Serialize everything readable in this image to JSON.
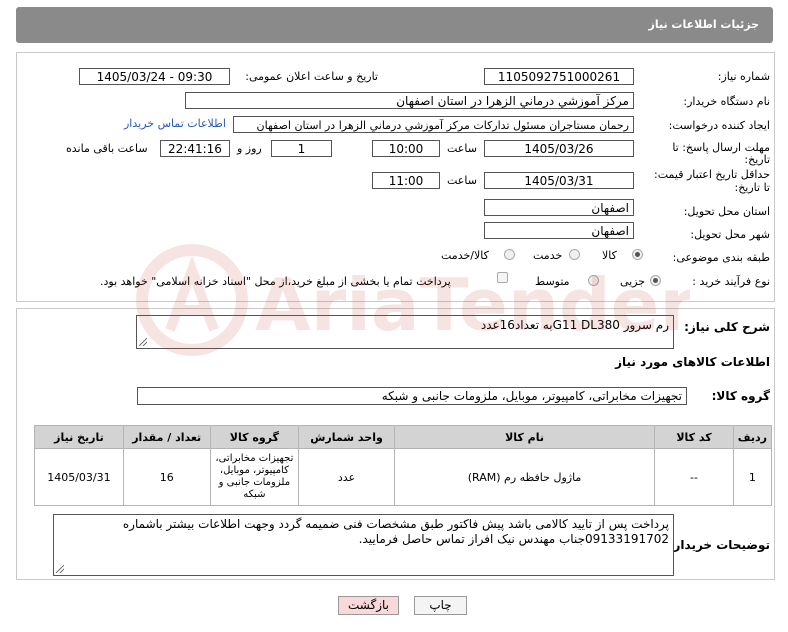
{
  "header": {
    "title": "جزئیات اطلاعات نیاز"
  },
  "need": {
    "number_label": "شماره نیاز:",
    "number": "1105092751000261",
    "announce_label": "تاریخ و ساعت اعلان عمومی:",
    "announce_value": "1405/03/24 - 09:30",
    "buyer_label": "نام دستگاه خریدار:",
    "buyer": "مرکز آموزشي درماني الزهرا در استان اصفهان",
    "creator_label": "ایجاد کننده درخواست:",
    "creator": "رحمان مستاجران مسئول تدارکات مرکز آموزشي درماني الزهرا در استان اصفهان",
    "contact_link": "اطلاعات تماس خریدار",
    "deadline_label_1": "مهلت ارسال پاسخ: تا",
    "deadline_label_2": "تاریخ:",
    "deadline_date": "1405/03/26",
    "time_label": "ساعت",
    "deadline_time": "10:00",
    "days_value": "1",
    "days_label": "روز و",
    "remaining_time": "22:41:16",
    "remaining_label": "ساعت باقی مانده",
    "validity_label_1": "حداقل تاریخ اعتبار قیمت:",
    "validity_label_2": "تا تاریخ:",
    "validity_date": "1405/03/31",
    "validity_time": "11:00",
    "province_label": "استان محل تحویل:",
    "province": "اصفهان",
    "city_label": "شهر محل تحویل:",
    "city": "اصفهان",
    "category_label": "طبقه بندی موضوعی:",
    "category_options": [
      "کالا",
      "خدمت",
      "کالا/خدمت"
    ],
    "category_selected": "کالا",
    "process_label": "نوع فرآیند خرید :",
    "process_options": [
      "جزیی",
      "متوسط"
    ],
    "process_selected": "جزیی",
    "payment_note": "پرداخت تمام یا بخشی از مبلغ خرید،از محل \"اسناد خزانه اسلامی\" خواهد بود."
  },
  "description": {
    "label": "شرح کلی نیاز:",
    "value": "رم سرور G11 DL380به تعداد16عدد"
  },
  "goods": {
    "section_title": "اطلاعات کالاهای مورد نیاز",
    "group_label": "گروه کالا:",
    "group_value": "تجهیزات مخابراتی، کامپیوتر، موبایل، ملزومات جانبی و شبکه",
    "columns": [
      "ردیف",
      "کد کالا",
      "نام کالا",
      "واحد شمارش",
      "گروه کالا",
      "تعداد / مقدار",
      "تاریخ نیاز"
    ],
    "rows": [
      {
        "row": "1",
        "code": "--",
        "name": "ماژول حافظه رم (RAM)",
        "unit": "عدد",
        "group": "تجهیزات مخابراتی، کامپیوتر، موبایل، ملزومات جانبی و شبکه",
        "qty": "16",
        "date": "1405/03/31"
      }
    ]
  },
  "buyer_notes": {
    "label": "توضیحات خریدار:",
    "value": "پرداخت پس از تایید کالامی باشد پیش فاکتور طبق مشخصات فنی ضمیمه گردد وجهت اطلاعات بیشتر باشماره 09133191702جناب مهندس نیک افراز تماس حاصل فرمایید."
  },
  "buttons": {
    "print": "چاپ",
    "back": "بازگشت"
  },
  "watermark": "AriaTender.net",
  "colors": {
    "header": "#8a8a8a",
    "link": "#2459b2",
    "back_button": "#f8d8d8",
    "watermark": "#c0392b"
  }
}
